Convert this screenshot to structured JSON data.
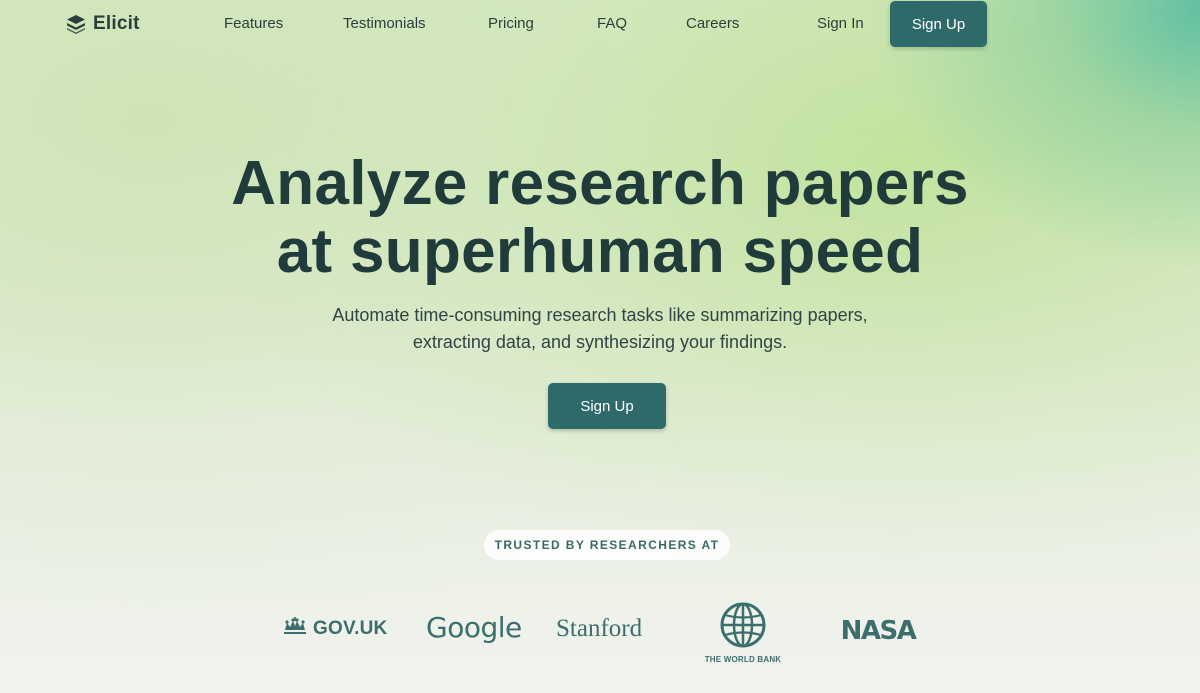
{
  "brand": {
    "name": "Elicit",
    "logo_icon": "elicit-logo-icon"
  },
  "nav": {
    "links": [
      {
        "label": "Features"
      },
      {
        "label": "Testimonials"
      },
      {
        "label": "Pricing"
      },
      {
        "label": "FAQ"
      },
      {
        "label": "Careers"
      }
    ],
    "sign_in": "Sign In",
    "sign_up": "Sign Up"
  },
  "hero": {
    "title_line1": "Analyze research papers",
    "title_line2": "at superhuman speed",
    "subtitle_line1": "Automate time-consuming research tasks like summarizing papers,",
    "subtitle_line2": "extracting data, and synthesizing your findings.",
    "cta": "Sign Up"
  },
  "trusted": {
    "badge": "TRUSTED BY RESEARCHERS AT",
    "logos": {
      "gov_uk": "GOV.UK",
      "google": "Google",
      "stanford": "Stanford",
      "world_bank": "THE WORLD BANK",
      "nasa": "NASA"
    }
  },
  "colors": {
    "primary_button": "#2f6a6b",
    "heading": "#1f3b3a",
    "logo_tint": "#3c6e6d"
  }
}
